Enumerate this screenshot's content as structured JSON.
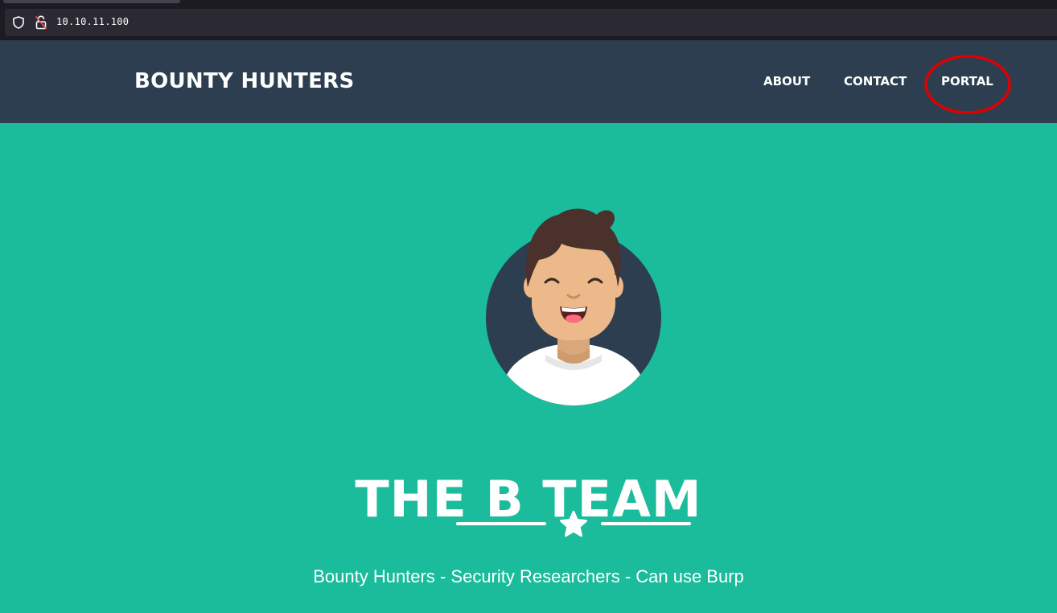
{
  "browser": {
    "url": "10.10.11.100"
  },
  "navbar": {
    "brand": "BOUNTY HUNTERS",
    "links": [
      {
        "label": "ABOUT"
      },
      {
        "label": "CONTACT"
      },
      {
        "label": "PORTAL"
      }
    ],
    "highlight_color": "#e00000"
  },
  "masthead": {
    "title": "THE B TEAM",
    "subtitle": "Bounty Hunters - Security Researchers - Can use Burp",
    "divider_icon": "star-icon",
    "avatar_icon": "avatar-icon"
  },
  "colors": {
    "navbar_bg": "#2c3e50",
    "masthead_bg": "#1abc9c",
    "text": "#ffffff"
  }
}
